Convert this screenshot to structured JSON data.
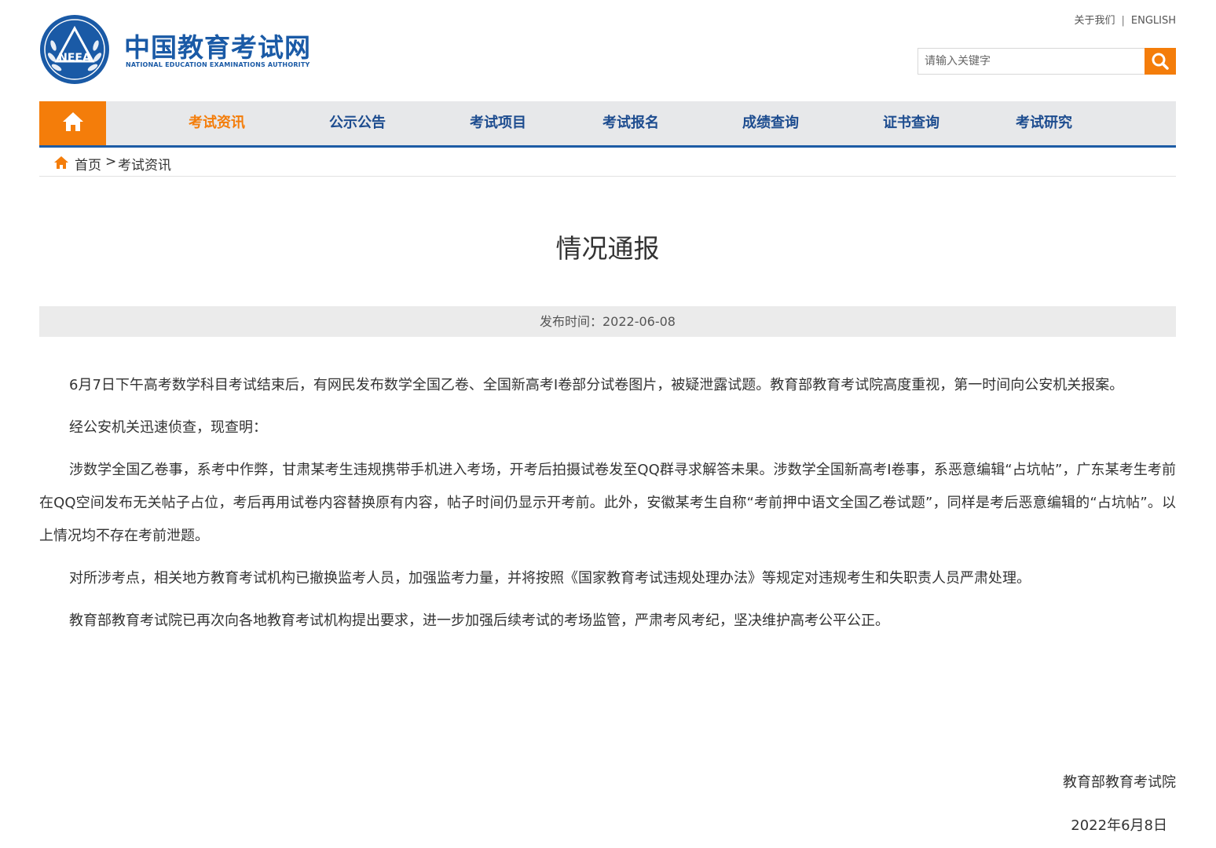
{
  "header": {
    "logo_text": "NEEA",
    "site_title": "中国教育考试网",
    "site_subtitle": "NATIONAL EDUCATION EXAMINATIONS AUTHORITY",
    "links": {
      "about": "关于我们",
      "separator": "|",
      "english": "ENGLISH"
    },
    "search": {
      "placeholder": "请输入关键字",
      "icon": "search-icon"
    }
  },
  "nav": {
    "home_icon": "home-icon",
    "items": [
      {
        "label": "考试资讯",
        "active": true
      },
      {
        "label": "公示公告"
      },
      {
        "label": "考试项目"
      },
      {
        "label": "考试报名"
      },
      {
        "label": "成绩查询"
      },
      {
        "label": "证书查询"
      },
      {
        "label": "考试研究"
      }
    ]
  },
  "breadcrumb": {
    "home": "首页",
    "separator": ">",
    "current": "考试资讯"
  },
  "article": {
    "title": "情况通报",
    "publish_time": "发布时间：2022-06-08",
    "paragraphs": [
      "6月7日下午高考数学科目考试结束后，有网民发布数学全国乙卷、全国新高考I卷部分试卷图片，被疑泄露试题。教育部教育考试院高度重视，第一时间向公安机关报案。",
      "经公安机关迅速侦查，现查明：",
      "涉数学全国乙卷事，系考中作弊，甘肃某考生违规携带手机进入考场，开考后拍摄试卷发至QQ群寻求解答未果。涉数学全国新高考I卷事，系恶意编辑“占坑帖”，广东某考生考前在QQ空间发布无关帖子占位，考后再用试卷内容替换原有内容，帖子时间仍显示开考前。此外，安徽某考生自称“考前押中语文全国乙卷试题”，同样是考后恶意编辑的“占坑帖”。以上情况均不存在考前泄题。",
      "对所涉考点，相关地方教育考试机构已撤换监考人员，加强监考力量，并将按照《国家教育考试违规处理办法》等规定对违规考生和失职责人员严肃处理。",
      "教育部教育考试院已再次向各地教育考试机构提出要求，进一步加强后续考试的考场监管，严肃考风考纪，坚决维护高考公平公正。"
    ],
    "signature": "教育部教育考试院",
    "date": "2022年6月8日"
  },
  "colors": {
    "accent": "#f47d0a",
    "brand": "#1d5ca5",
    "nav_bg": "#e7e8ea"
  }
}
